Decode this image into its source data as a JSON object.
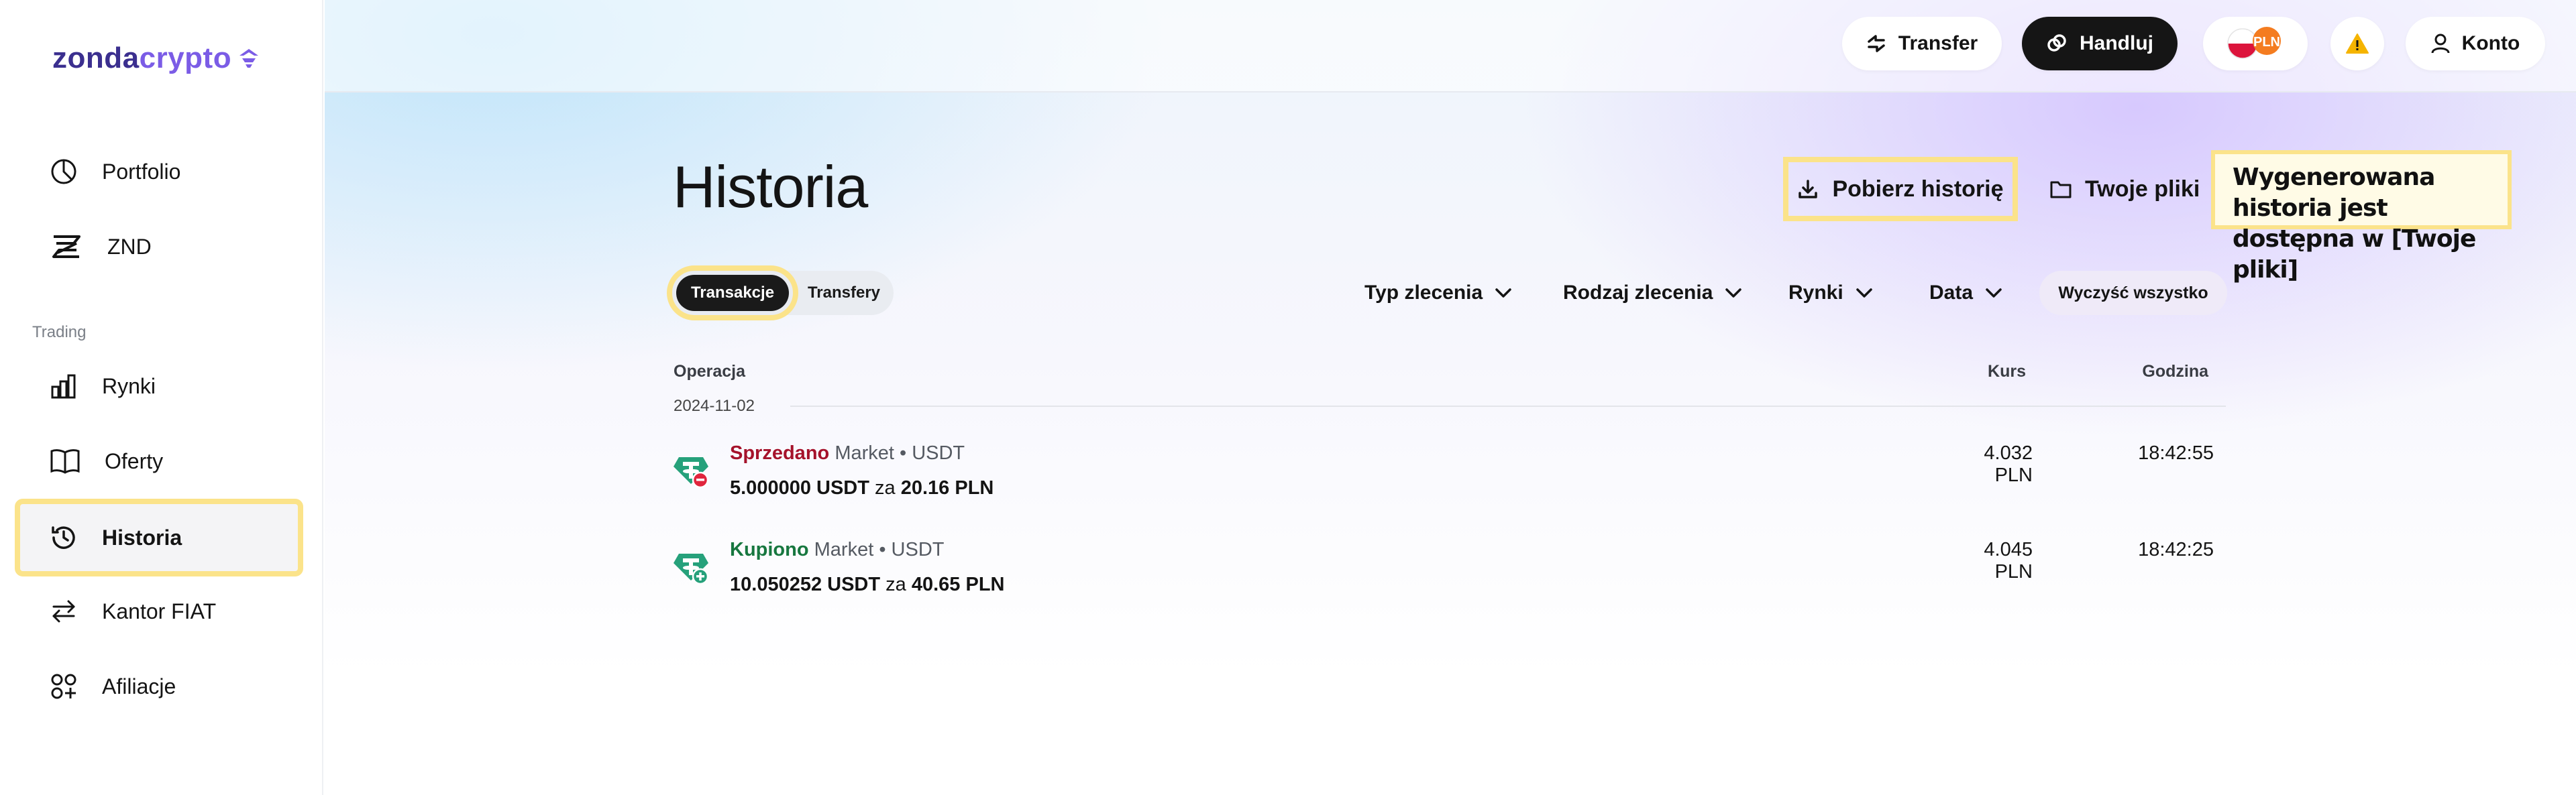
{
  "brand": {
    "logo_part1": "zonda",
    "logo_part2": "crypto"
  },
  "sidebar": {
    "section_label": "Trading",
    "items": [
      {
        "label": "Portfolio",
        "icon": "pie-chart-icon"
      },
      {
        "label": "ZND",
        "icon": "znd-icon"
      },
      {
        "label": "Rynki",
        "icon": "bar-chart-icon"
      },
      {
        "label": "Oferty",
        "icon": "book-icon"
      },
      {
        "label": "Historia",
        "icon": "history-icon",
        "active": true
      },
      {
        "label": "Kantor FIAT",
        "icon": "arrows-swap-icon"
      },
      {
        "label": "Afiliacje",
        "icon": "affiliates-icon"
      }
    ]
  },
  "topbar": {
    "transfer_label": "Transfer",
    "trade_label": "Handluj",
    "currency_label": "PLN",
    "account_label": "Konto"
  },
  "page": {
    "title": "Historia",
    "download_label": "Pobierz historię",
    "files_label": "Twoje pliki",
    "tooltip_text": "Wygenerowana historia jest dostępna w [Twoje pliki]"
  },
  "tabs": {
    "active": "Transakcje",
    "other": "Transfery"
  },
  "filters": {
    "order_type": "Typ zlecenia",
    "order_kind": "Rodzaj zlecenia",
    "markets": "Rynki",
    "date": "Data",
    "clear_all": "Wyczyść wszystko"
  },
  "table": {
    "col_operation": "Operacja",
    "col_rate": "Kurs",
    "col_time": "Godzina",
    "date_group": "2024-11-02",
    "rows": [
      {
        "action": "Sprzedano",
        "meta": "Market • USDT",
        "amount": "5.000000 USDT",
        "connector": "za",
        "total": "20.16 PLN",
        "rate": "4.032 PLN",
        "time": "18:42:55"
      },
      {
        "action": "Kupiono",
        "meta": "Market • USDT",
        "amount": "10.050252 USDT",
        "connector": "za",
        "total": "40.65 PLN",
        "rate": "4.045 PLN",
        "time": "18:42:25"
      }
    ]
  },
  "colors": {
    "sell": "#a5122b",
    "buy": "#17773f",
    "tether": "#26a17b",
    "highlight": "#fbe38a",
    "warning": "#f5b400",
    "pln_badge": "#f47c20"
  }
}
